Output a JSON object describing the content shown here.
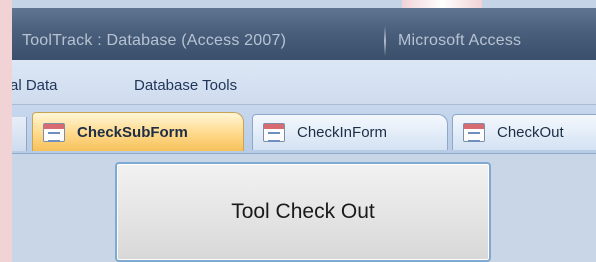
{
  "window": {
    "title_app": "ToolTrack : Database (Access 2007)",
    "title_product": "Microsoft Access"
  },
  "ribbon": {
    "tabs": [
      {
        "label": "al Data"
      },
      {
        "label": "Database Tools"
      }
    ]
  },
  "document_tabs": [
    {
      "label": "CheckSubForm",
      "active": true,
      "icon": "form-icon"
    },
    {
      "label": "CheckInForm",
      "active": false,
      "icon": "form-icon"
    },
    {
      "label": "CheckOut",
      "active": false,
      "icon": "form-icon"
    }
  ],
  "form": {
    "check_out_button_label": "Tool Check Out"
  },
  "colors": {
    "active_tab": "#f6c15a",
    "title_bar": "#495f7c",
    "ribbon": "#dce7f5"
  }
}
